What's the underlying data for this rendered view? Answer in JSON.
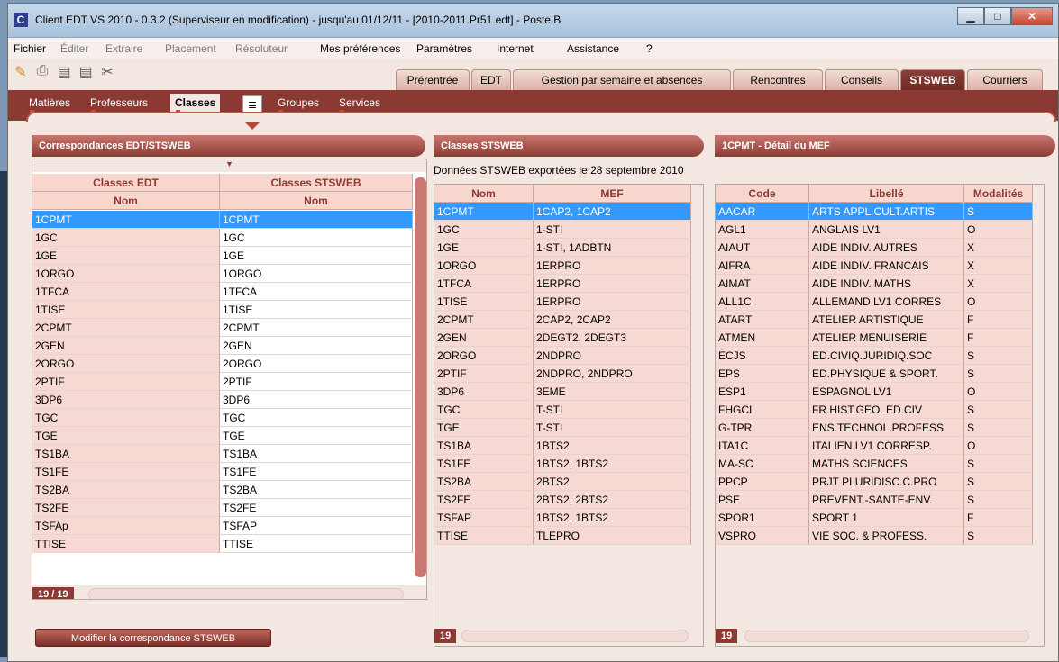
{
  "title": "Client EDT VS 2010 - 0.3.2 (Superviseur en modification) - jusqu'au 01/12/11 - [2010-2011.Pr51.edt] - Poste B",
  "menu": [
    {
      "label": "Fichier",
      "disabled": false
    },
    {
      "label": "Éditer",
      "disabled": true
    },
    {
      "label": "Extraire",
      "disabled": true
    },
    {
      "label": "Placement",
      "disabled": true
    },
    {
      "label": "Résoluteur",
      "disabled": true
    },
    {
      "label": "Mes préférences",
      "disabled": false
    },
    {
      "label": "Paramètres",
      "disabled": false
    },
    {
      "label": "Internet",
      "disabled": false
    },
    {
      "label": "Assistance",
      "disabled": false
    },
    {
      "label": "?",
      "disabled": false
    }
  ],
  "main_tabs": [
    "Prérentrée",
    "EDT",
    "Gestion par semaine et absences",
    "Rencontres",
    "Conseils",
    "STSWEB",
    "Courriers"
  ],
  "sub_tabs": [
    "Matières",
    "Professeurs",
    "Classes",
    "Groupes",
    "Services"
  ],
  "panel_left": {
    "title": "Correspondances EDT/STSWEB",
    "col1_group": "Classes EDT",
    "col2_group": "Classes STSWEB",
    "col_nom": "Nom",
    "rows": [
      [
        "1CPMT",
        "1CPMT"
      ],
      [
        "1GC",
        "1GC"
      ],
      [
        "1GE",
        "1GE"
      ],
      [
        "1ORGO",
        "1ORGO"
      ],
      [
        "1TFCA",
        "1TFCA"
      ],
      [
        "1TISE",
        "1TISE"
      ],
      [
        "2CPMT",
        "2CPMT"
      ],
      [
        "2GEN",
        "2GEN"
      ],
      [
        "2ORGO",
        "2ORGO"
      ],
      [
        "2PTIF",
        "2PTIF"
      ],
      [
        "3DP6",
        "3DP6"
      ],
      [
        "TGC",
        "TGC"
      ],
      [
        "TGE",
        "TGE"
      ],
      [
        "TS1BA",
        "TS1BA"
      ],
      [
        "TS1FE",
        "TS1FE"
      ],
      [
        "TS2BA",
        "TS2BA"
      ],
      [
        "TS2FE",
        "TS2FE"
      ],
      [
        "TSFAp",
        "TSFAP"
      ],
      [
        "TTISE",
        "TTISE"
      ]
    ],
    "count": "19 / 19",
    "button": "Modifier la correspondance STSWEB"
  },
  "panel_mid": {
    "title": "Classes STSWEB",
    "info": "Données STSWEB exportées le 28 septembre 2010",
    "col_nom": "Nom",
    "col_mef": "MEF",
    "rows": [
      [
        "1CPMT",
        "1CAP2, 1CAP2"
      ],
      [
        "1GC",
        "1-STI"
      ],
      [
        "1GE",
        "1-STI, 1ADBTN"
      ],
      [
        "1ORGO",
        "1ERPRO"
      ],
      [
        "1TFCA",
        "1ERPRO"
      ],
      [
        "1TISE",
        "1ERPRO"
      ],
      [
        "2CPMT",
        "2CAP2, 2CAP2"
      ],
      [
        "2GEN",
        "2DEGT2, 2DEGT3"
      ],
      [
        "2ORGO",
        "2NDPRO"
      ],
      [
        "2PTIF",
        "2NDPRO, 2NDPRO"
      ],
      [
        "3DP6",
        "3EME"
      ],
      [
        "TGC",
        "T-STI"
      ],
      [
        "TGE",
        "T-STI"
      ],
      [
        "TS1BA",
        "1BTS2"
      ],
      [
        "TS1FE",
        "1BTS2, 1BTS2"
      ],
      [
        "TS2BA",
        "2BTS2"
      ],
      [
        "TS2FE",
        "2BTS2, 2BTS2"
      ],
      [
        "TSFAP",
        "1BTS2, 1BTS2"
      ],
      [
        "TTISE",
        "TLEPRO"
      ]
    ],
    "count": "19"
  },
  "panel_right": {
    "title": "1CPMT - Détail du MEF",
    "col_code": "Code",
    "col_libelle": "Libellé",
    "col_mod": "Modalités",
    "rows": [
      [
        "AACAR",
        "ARTS APPL.CULT.ARTIS",
        "S"
      ],
      [
        "AGL1",
        "ANGLAIS LV1",
        "O"
      ],
      [
        "AIAUT",
        "AIDE INDIV. AUTRES",
        "X"
      ],
      [
        "AIFRA",
        "AIDE INDIV. FRANCAIS",
        "X"
      ],
      [
        "AIMAT",
        "AIDE INDIV. MATHS",
        "X"
      ],
      [
        "ALL1C",
        "ALLEMAND LV1 CORRES",
        "O"
      ],
      [
        "ATART",
        "ATELIER ARTISTIQUE",
        "F"
      ],
      [
        "ATMEN",
        "ATELIER MENUISERIE",
        "F"
      ],
      [
        "ECJS",
        "ED.CIVIQ.JURIDIQ.SOC",
        "S"
      ],
      [
        "EPS",
        "ED.PHYSIQUE & SPORT.",
        "S"
      ],
      [
        "ESP1",
        "ESPAGNOL LV1",
        "O"
      ],
      [
        "FHGCI",
        "FR.HIST.GEO. ED.CIV",
        "S"
      ],
      [
        "G-TPR",
        "ENS.TECHNOL.PROFESS",
        "S"
      ],
      [
        "ITA1C",
        "ITALIEN LV1 CORRESP.",
        "O"
      ],
      [
        "MA-SC",
        "MATHS SCIENCES",
        "S"
      ],
      [
        "PPCP",
        "PRJT PLURIDISC.C.PRO",
        "S"
      ],
      [
        "PSE",
        "PREVENT.-SANTE-ENV.",
        "S"
      ],
      [
        "SPOR1",
        "SPORT 1",
        "F"
      ],
      [
        "VSPRO",
        "VIE SOC. & PROFESS.",
        "S"
      ]
    ],
    "count": "19"
  }
}
